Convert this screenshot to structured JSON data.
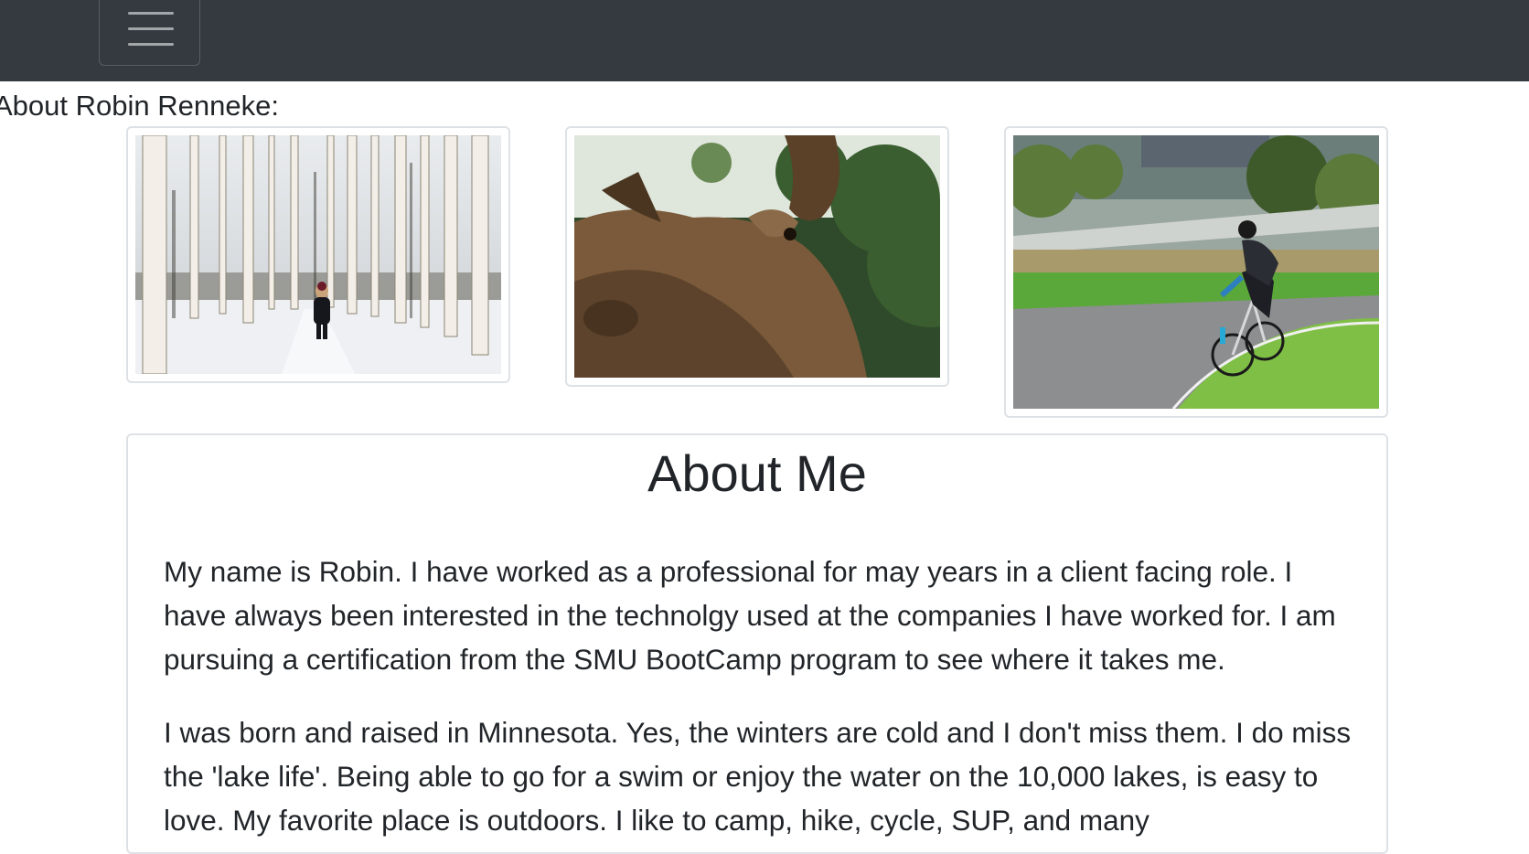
{
  "navbar": {
    "toggle_icon": "hamburger-icon"
  },
  "intro": {
    "text": "About Robin Renneke:"
  },
  "gallery": [
    {
      "icon": "winter-forest-photo"
    },
    {
      "icon": "moose-photo"
    },
    {
      "icon": "cyclist-photo"
    }
  ],
  "about": {
    "heading": "About Me",
    "paragraphs": [
      "My name is Robin. I have worked as a professional for may years in a client facing role. I have always been interested in the technolgy used at the companies I have worked for. I am pursuing a certification from the SMU BootCamp program to see where it takes me.",
      "I was born and raised in Minnesota. Yes, the winters are cold and I don't miss them. I do miss the 'lake life'. Being able to go for a swim or enjoy the water on the 10,000 lakes, is easy to love. My favorite place is outdoors. I like to camp, hike, cycle, SUP, and many"
    ]
  },
  "colors": {
    "navbar": "#343a40",
    "border": "#dee2e6",
    "text": "#212529"
  }
}
